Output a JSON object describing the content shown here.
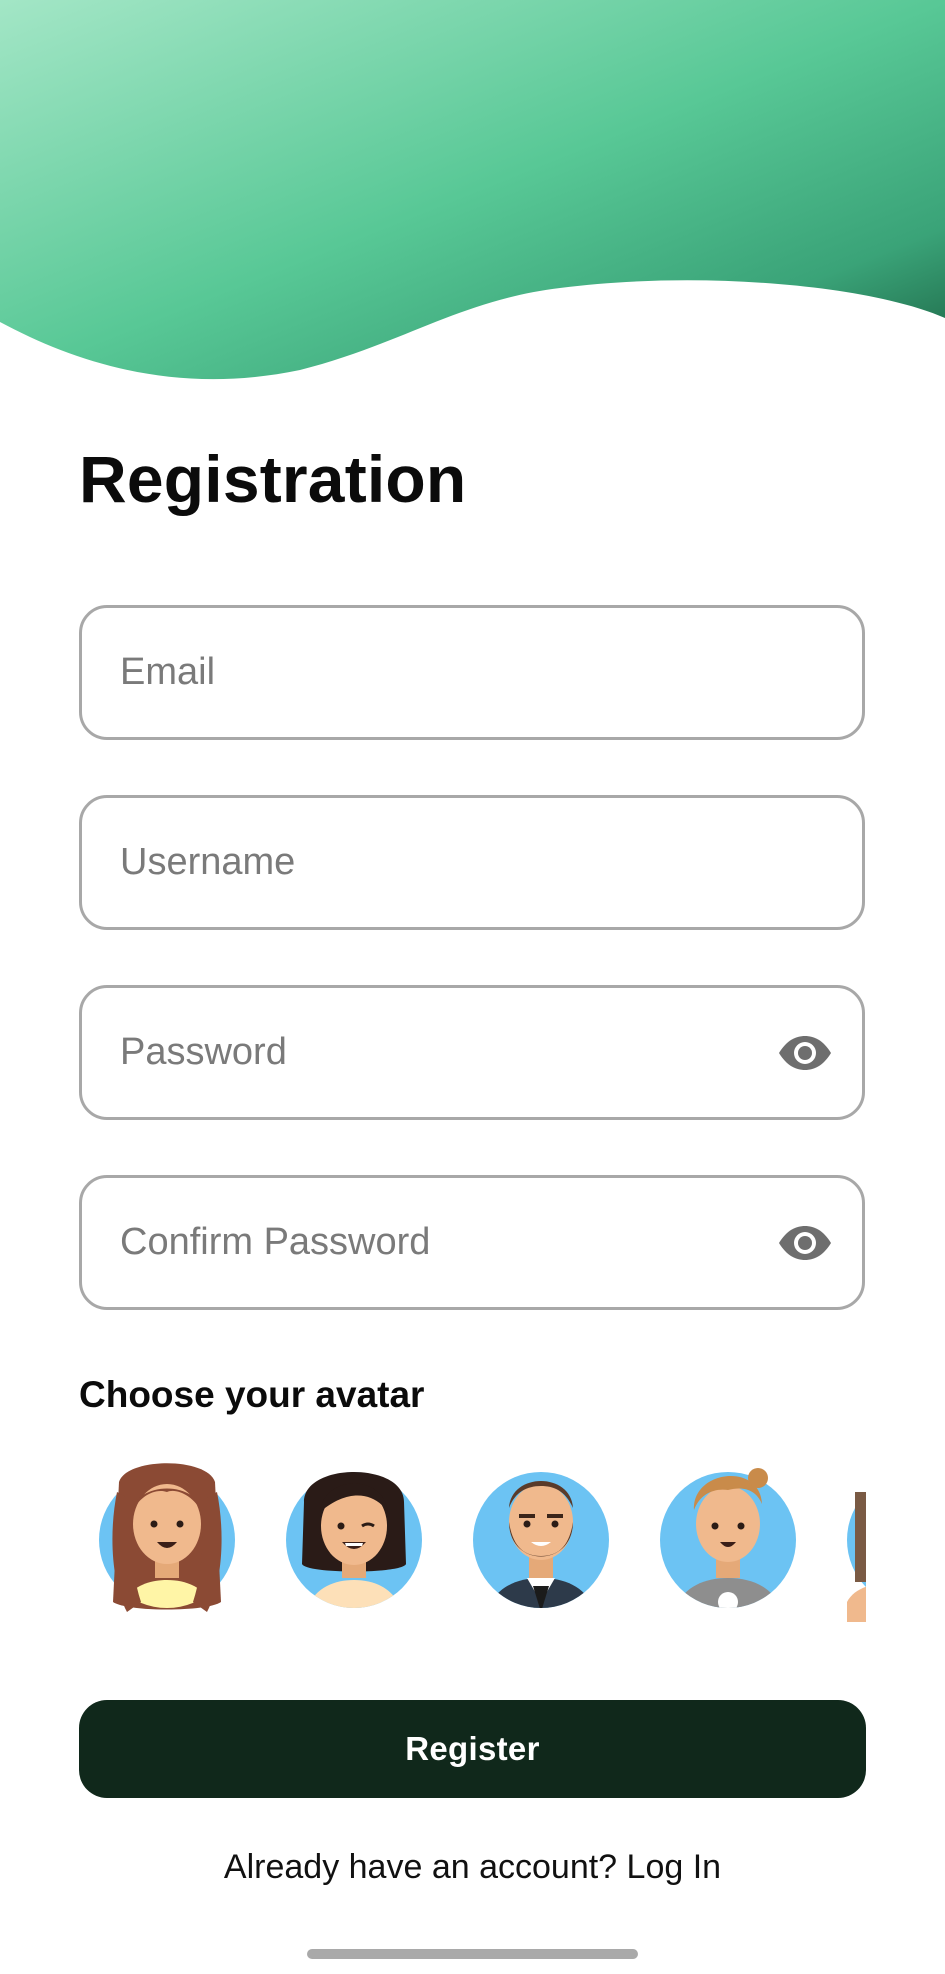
{
  "header": {
    "gradient_colors": [
      "#9fe3c3",
      "#55c795",
      "#1f6e4c"
    ]
  },
  "form": {
    "title": "Registration",
    "email_placeholder": "Email",
    "username_placeholder": "Username",
    "password_placeholder": "Password",
    "confirm_password_placeholder": "Confirm Password",
    "avatar_heading": "Choose your avatar"
  },
  "avatars": [
    {
      "icon": "woman-long-brown-hair-avatar-icon"
    },
    {
      "icon": "woman-dark-bob-hair-avatar-icon"
    },
    {
      "icon": "man-beard-suit-avatar-icon"
    },
    {
      "icon": "man-blond-hair-avatar-icon"
    },
    {
      "icon": "partial-avatar-icon"
    }
  ],
  "actions": {
    "register_label": "Register",
    "login_prompt": "Already have an account?",
    "login_link": "Log In",
    "button_color": "#10281b"
  }
}
